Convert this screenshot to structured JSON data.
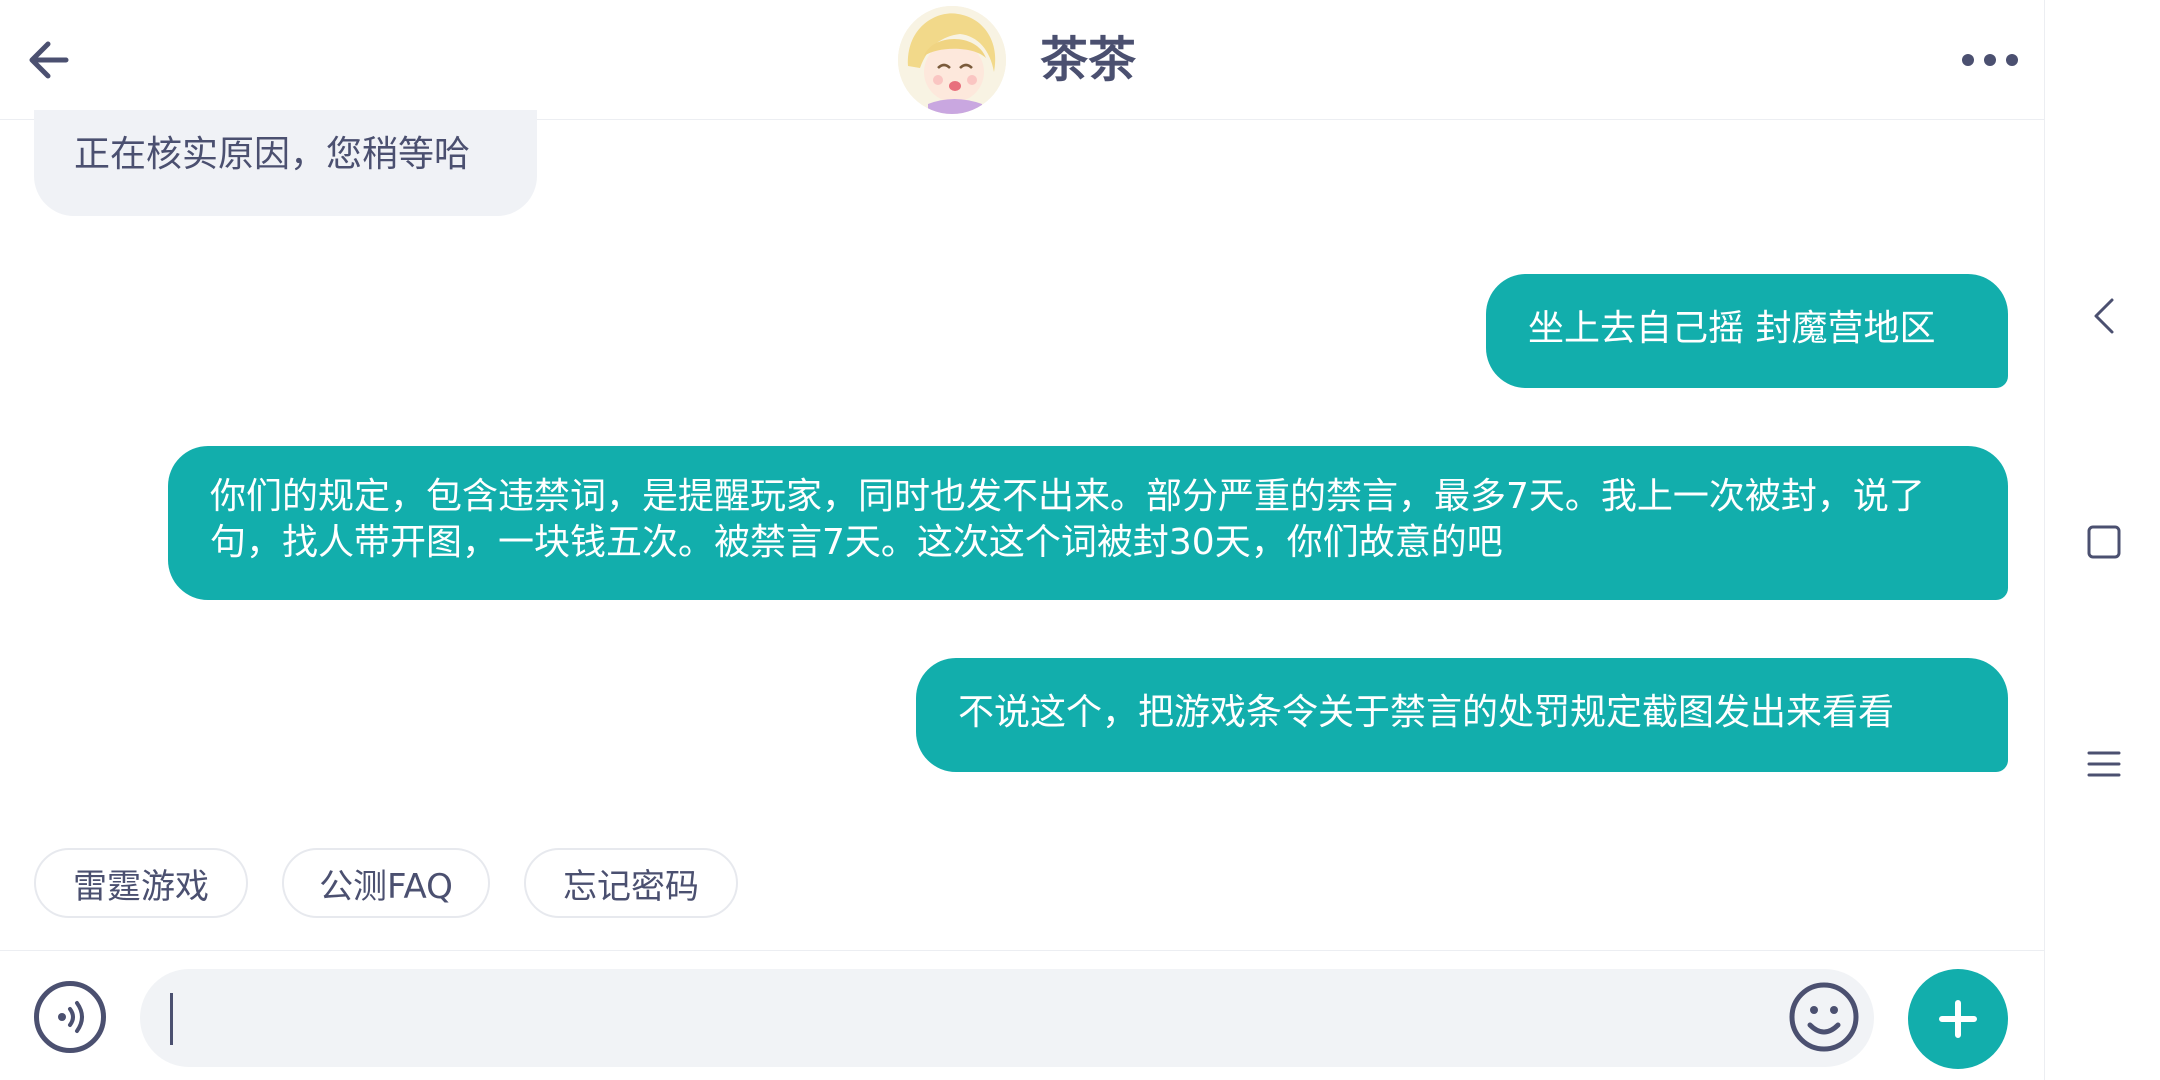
{
  "header": {
    "title": "茶茶",
    "back_icon": "arrow-left-icon",
    "more_icon": "more-horizontal-icon"
  },
  "messages": [
    {
      "side": "left",
      "text": "正在核实原因，您稍等哈"
    },
    {
      "side": "right",
      "text": "坐上去自己摇 封魔营地区"
    },
    {
      "side": "right",
      "text": "你们的规定，包含违禁词，是提醒玩家，同时也发不出来。部分严重的禁言，最多7天。我上一次被封，说了句，找人带开图，一块钱五次。被禁言7天。这次这个词被封30天，你们故意的吧"
    },
    {
      "side": "right",
      "text": "不说这个，把游戏条令关于禁言的处罚规定截图发出来看看"
    }
  ],
  "quick_replies": [
    {
      "label": "雷霆游戏"
    },
    {
      "label": "公测FAQ"
    },
    {
      "label": "忘记密码"
    }
  ],
  "input": {
    "value": "",
    "voice_icon": "voice-icon",
    "emoji_icon": "smiley-icon",
    "plus_icon": "plus-icon"
  },
  "system_nav": {
    "back_icon": "chevron-left-icon",
    "home_icon": "square-icon",
    "menu_icon": "hamburger-icon"
  },
  "colors": {
    "accent": "#12aeac",
    "text": "#4b5070",
    "bubble_left": "#f0f2f6"
  }
}
